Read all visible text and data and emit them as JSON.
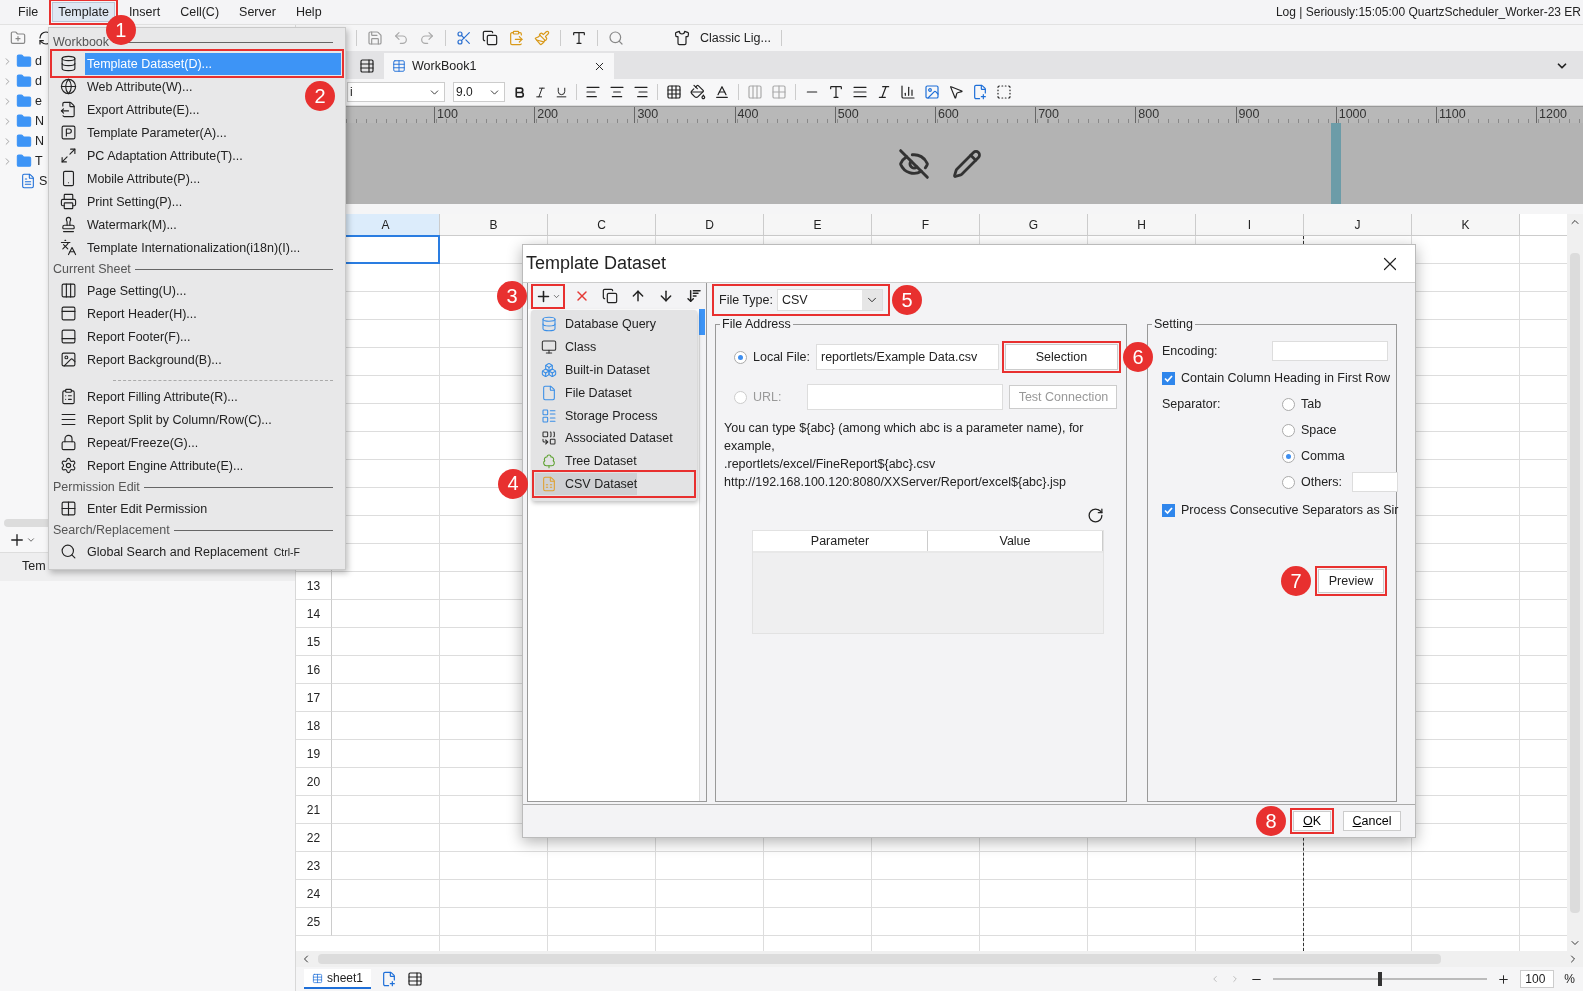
{
  "menu_bar": {
    "items": [
      {
        "label": "File",
        "selected": false
      },
      {
        "label": "Template",
        "selected": true,
        "callout": "1"
      },
      {
        "label": "Insert",
        "selected": false
      },
      {
        "label": "Cell(C)",
        "selected": false
      },
      {
        "label": "Server",
        "selected": false
      },
      {
        "label": "Help",
        "selected": false
      }
    ],
    "status_text": "Log | Seriously:15:05:00 QuartzScheduler_Worker-23 ER"
  },
  "left_panel": {
    "tree": [
      {
        "label": "d",
        "kind": "folder"
      },
      {
        "label": "d",
        "kind": "folder"
      },
      {
        "label": "e",
        "kind": "folder"
      },
      {
        "label": "N",
        "kind": "folder"
      },
      {
        "label": "N",
        "kind": "folder"
      },
      {
        "label": "T",
        "kind": "folder"
      },
      {
        "label": "S",
        "kind": "report"
      }
    ],
    "tab_label": "Tem"
  },
  "toolbar": {
    "theme_label": "Classic Lig..."
  },
  "tabs": [
    {
      "label": "WorkBook1",
      "selected": true
    }
  ],
  "format_bar": {
    "font": "i",
    "size": "9.0"
  },
  "ruler_labels": [
    "100",
    "200",
    "300",
    "400",
    "500",
    "600",
    "700",
    "800",
    "900",
    "1000",
    "1100",
    "1200"
  ],
  "columns": [
    "A",
    "B",
    "C",
    "D",
    "E",
    "F",
    "G",
    "H",
    "I",
    "J",
    "K"
  ],
  "row_numbers": [
    "13",
    "14",
    "15",
    "16",
    "17",
    "18",
    "19",
    "20",
    "21",
    "22",
    "23",
    "24",
    "25"
  ],
  "sheet_bar": {
    "sheets": [
      {
        "label": "sheet1",
        "selected": true
      }
    ],
    "zoom": "100",
    "zoom_unit": "%",
    "zoom_slider": {
      "level": 0.5
    }
  },
  "template_menu": {
    "sections": [
      {
        "title": "Workbook",
        "items": [
          {
            "label": "Template Dataset(D)...",
            "selected": true,
            "callout": "2"
          },
          {
            "label": "Web Attribute(W)...",
            "selected": false
          },
          {
            "label": "Export Attribute(E)...",
            "selected": false
          },
          {
            "label": "Template Parameter(A)...",
            "selected": false
          },
          {
            "label": "PC Adaptation Attribute(T)...",
            "selected": false
          },
          {
            "label": "Mobile Attribute(P)...",
            "selected": false
          },
          {
            "label": "Print Setting(P)...",
            "selected": false
          },
          {
            "label": "Watermark(M)...",
            "selected": false
          },
          {
            "label": "Template Internationalization(i18n)(I)...",
            "selected": false
          }
        ]
      },
      {
        "title": "Current Sheet",
        "items": [
          {
            "label": "Page Setting(U)...",
            "selected": false
          },
          {
            "label": "Report Header(H)...",
            "selected": false
          },
          {
            "label": "Report Footer(F)...",
            "selected": false
          },
          {
            "label": "Report Background(B)...",
            "selected": false
          }
        ]
      },
      {
        "items": [
          {
            "label": "Report Filling Attribute(R)...",
            "selected": false
          },
          {
            "label": "Report Split by Column/Row(C)...",
            "selected": false
          },
          {
            "label": "Repeat/Freeze(G)...",
            "selected": false
          },
          {
            "label": "Report Engine Attribute(E)...",
            "selected": false
          }
        ]
      },
      {
        "title": "Permission Edit",
        "items": [
          {
            "label": "Enter Edit Permission",
            "selected": false
          }
        ]
      },
      {
        "title": "Search/Replacement",
        "items": [
          {
            "label": "Global Search and Replacement",
            "selected": false,
            "shortcut": "Ctrl-F"
          }
        ]
      }
    ]
  },
  "dialog": {
    "title": "Template Dataset",
    "add_callout": "3",
    "dataset_menu": [
      {
        "label": "Database Query",
        "selected": false
      },
      {
        "label": "Class",
        "selected": false
      },
      {
        "label": "Built-in Dataset",
        "selected": false
      },
      {
        "label": "File Dataset",
        "selected": false
      },
      {
        "label": "Storage Process",
        "selected": false
      },
      {
        "label": "Associated Dataset",
        "selected": false
      },
      {
        "label": "Tree Dataset",
        "selected": false
      },
      {
        "label": "CSV Dataset",
        "selected": true,
        "callout": "4"
      }
    ],
    "file_type": {
      "label": "File Type:",
      "value": "CSV",
      "callout": "5"
    },
    "file_address": {
      "title": "File Address",
      "local_file": {
        "label": "Local File:",
        "selected": true,
        "value": "reportlets/Example Data.csv"
      },
      "selection_button": {
        "label": "Selection",
        "callout": "6"
      },
      "url": {
        "label": "URL:",
        "selected": false,
        "disabled": true
      },
      "test_button": {
        "label": "Test Connection",
        "disabled": true
      },
      "hint_lines": [
        "You can type ${abc} (among which abc is a parameter name), for example,",
        ".reportlets/excel/FineReport${abc}.csv",
        "http://192.168.100.120:8080/XXServer/Report/excel${abc}.jsp"
      ],
      "table_columns": [
        "Parameter",
        "Value"
      ]
    },
    "setting": {
      "title": "Setting",
      "encoding_label": "Encoding:",
      "contain_heading": {
        "label": "Contain Column Heading in First Row",
        "checked": true
      },
      "separator_label": "Separator:",
      "separators": [
        {
          "label": "Tab",
          "selected": false
        },
        {
          "label": "Space",
          "selected": false
        },
        {
          "label": "Comma",
          "selected": true
        },
        {
          "label": "Others:",
          "selected": false,
          "kind": "other"
        }
      ],
      "consecutive": {
        "label": "Process Consecutive Separators as Sir",
        "checked": true
      },
      "preview": {
        "label": "Preview",
        "callout": "7"
      }
    },
    "buttons": [
      {
        "label": "OK",
        "callout": "8"
      },
      {
        "label": "Cancel"
      }
    ]
  }
}
